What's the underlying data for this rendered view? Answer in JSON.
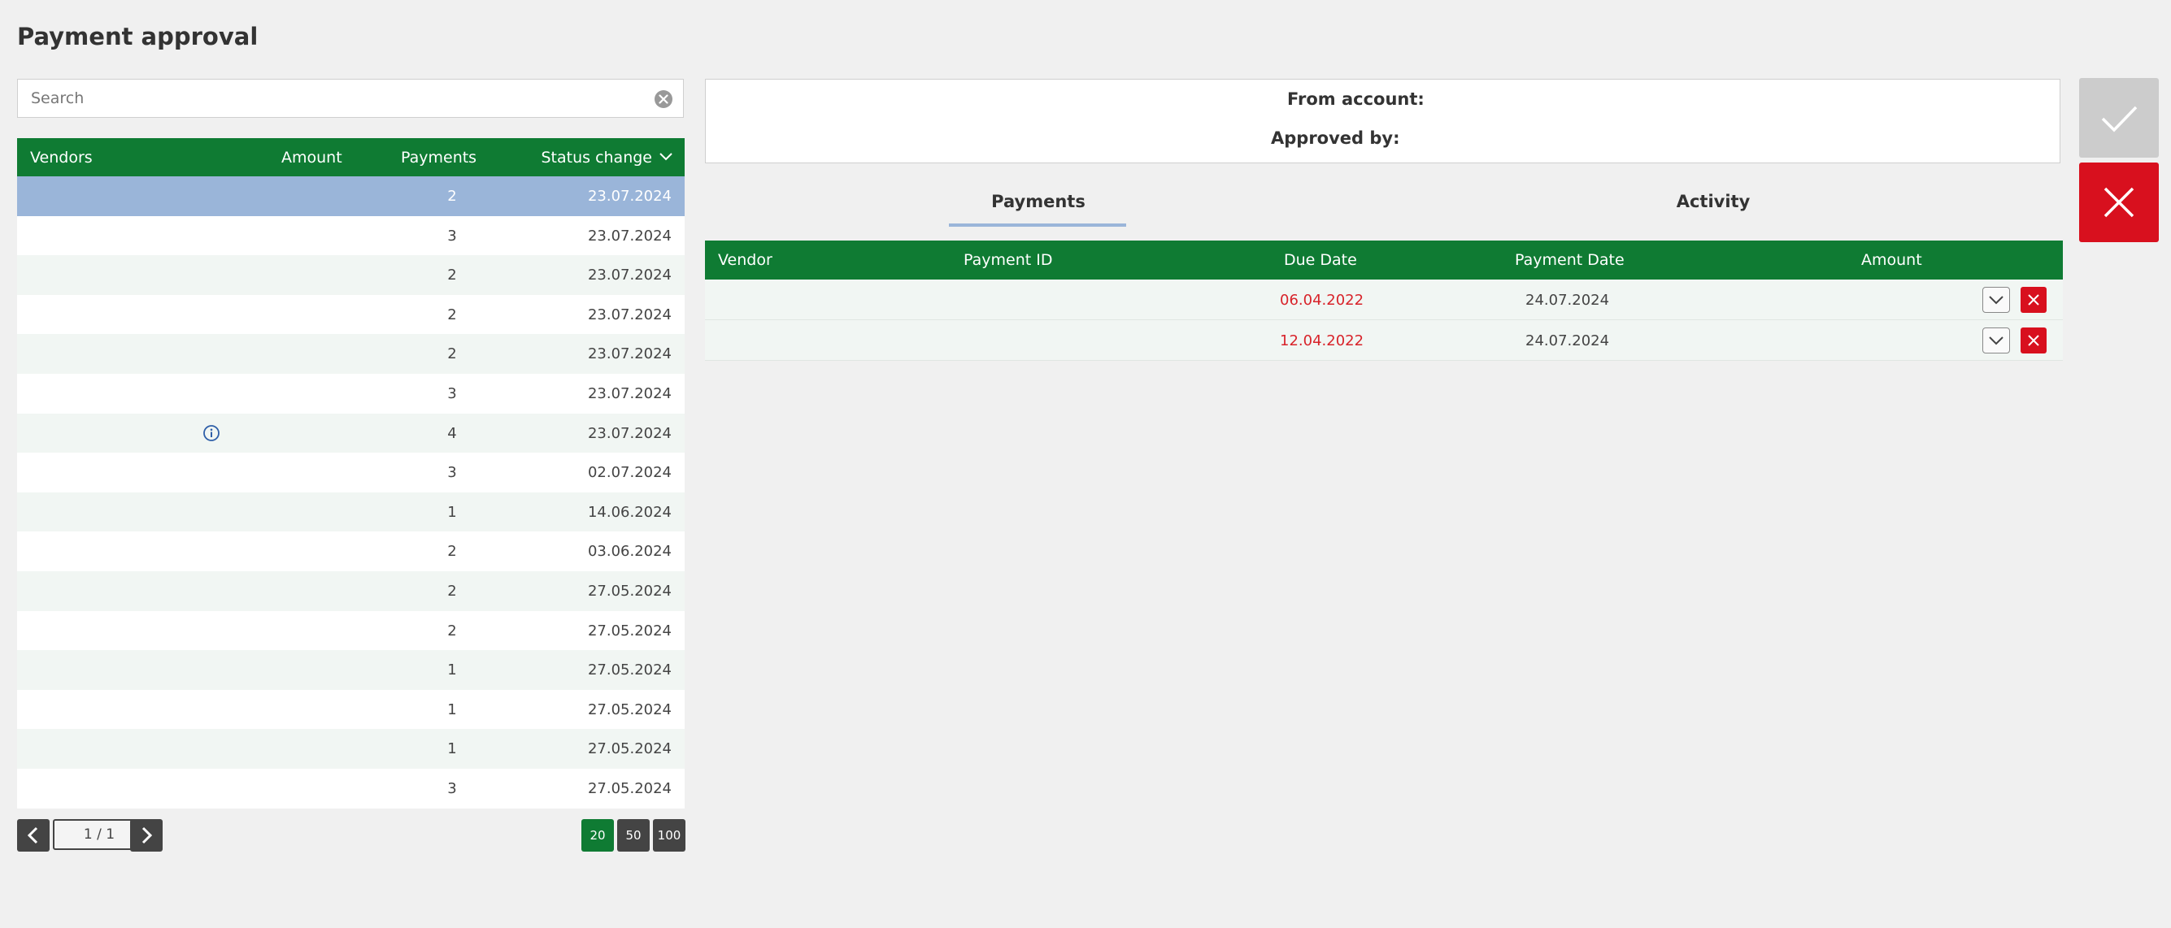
{
  "page": {
    "title": "Payment approval"
  },
  "search": {
    "placeholder": "Search"
  },
  "vendors_table": {
    "columns": {
      "vendors": "Vendors",
      "amount": "Amount",
      "payments": "Payments",
      "status_change": "Status change"
    },
    "rows": [
      {
        "payments": "2",
        "status_change": "23.07.2024",
        "selected": true
      },
      {
        "payments": "3",
        "status_change": "23.07.2024"
      },
      {
        "payments": "2",
        "status_change": "23.07.2024"
      },
      {
        "payments": "2",
        "status_change": "23.07.2024"
      },
      {
        "payments": "2",
        "status_change": "23.07.2024"
      },
      {
        "payments": "3",
        "status_change": "23.07.2024"
      },
      {
        "payments": "4",
        "status_change": "23.07.2024",
        "info_icon": true
      },
      {
        "payments": "3",
        "status_change": "02.07.2024"
      },
      {
        "payments": "1",
        "status_change": "14.06.2024"
      },
      {
        "payments": "2",
        "status_change": "03.06.2024"
      },
      {
        "payments": "2",
        "status_change": "27.05.2024"
      },
      {
        "payments": "2",
        "status_change": "27.05.2024"
      },
      {
        "payments": "1",
        "status_change": "27.05.2024"
      },
      {
        "payments": "1",
        "status_change": "27.05.2024"
      },
      {
        "payments": "1",
        "status_change": "27.05.2024"
      },
      {
        "payments": "3",
        "status_change": "27.05.2024"
      }
    ]
  },
  "pagination": {
    "page_indicator": "1 / 1",
    "page_sizes": [
      "20",
      "50",
      "100"
    ],
    "active_size": "20"
  },
  "details": {
    "from_account_label": "From account:",
    "approved_by_label": "Approved by:"
  },
  "tabs": {
    "payments": "Payments",
    "activity": "Activity",
    "active": "Payments"
  },
  "payments_table": {
    "columns": {
      "vendor": "Vendor",
      "payment_id": "Payment ID",
      "due_date": "Due Date",
      "payment_date": "Payment Date",
      "amount": "Amount"
    },
    "rows": [
      {
        "due_date": "06.04.2022",
        "payment_date": "24.07.2024"
      },
      {
        "due_date": "12.04.2022",
        "payment_date": "24.07.2024"
      }
    ]
  },
  "colors": {
    "header_green": "#0f7b33",
    "selected_row": "#9ab5d9",
    "reject_red": "#d8101e",
    "overdue_red": "#d8232a",
    "approve_gray": "#cccccc"
  }
}
